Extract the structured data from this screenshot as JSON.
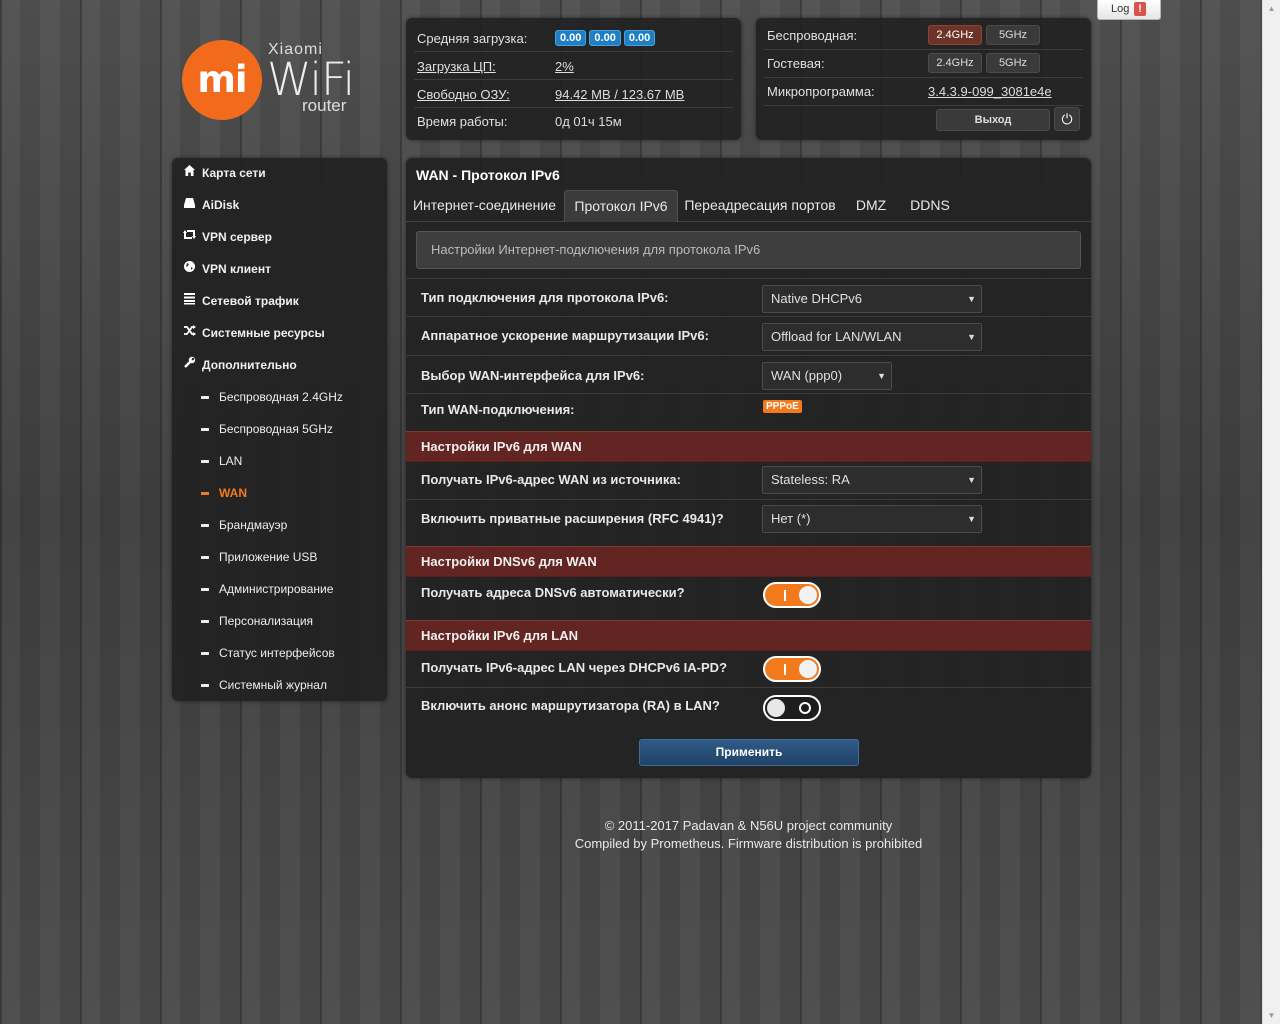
{
  "log_button": {
    "label": "Log",
    "alert": "!"
  },
  "logo": {
    "mark": "mi",
    "brand": "Xiaomi",
    "wifi": "WiFi",
    "router": "router"
  },
  "status": {
    "load_label": "Средняя загрузка:",
    "load_values": [
      "0.00",
      "0.00",
      "0.00"
    ],
    "cpu_label": "Загрузка ЦП:",
    "cpu_value": "2%",
    "ram_label": "Свободно ОЗУ:",
    "ram_value": "94.42 MB / 123.67 MB",
    "uptime_label": "Время работы:",
    "uptime_value": "0д 01ч 15м"
  },
  "wireless": {
    "wireless_label": "Беспроводная:",
    "guest_label": "Гостевая:",
    "band_24": "2.4GHz",
    "band_5": "5GHz",
    "firmware_label": "Микропрограмма:",
    "firmware_value": "3.4.3.9-099_3081e4e",
    "logout_label": "Выход"
  },
  "sidebar": {
    "items": [
      {
        "label": "Карта сети",
        "icon": "home-icon"
      },
      {
        "label": "AiDisk",
        "icon": "disk-icon"
      },
      {
        "label": "VPN сервер",
        "icon": "retweet-icon"
      },
      {
        "label": "VPN клиент",
        "icon": "globe-icon"
      },
      {
        "label": "Сетевой трафик",
        "icon": "list-icon"
      },
      {
        "label": "Системные ресурсы",
        "icon": "random-icon"
      },
      {
        "label": "Дополнительно",
        "icon": "wrench-icon"
      }
    ],
    "subitems": [
      "Беспроводная 2.4GHz",
      "Беспроводная 5GHz",
      "LAN",
      "WAN",
      "Брандмауэр",
      "Приложение USB",
      "Администрирование",
      "Персонализация",
      "Статус интерфейсов",
      "Системный журнал"
    ],
    "active": "WAN"
  },
  "main": {
    "title": "WAN - Протокол IPv6",
    "tabs": [
      "Интернет-соединение",
      "Протокол IPv6",
      "Переадресация портов",
      "DMZ",
      "DDNS"
    ],
    "active_tab": "Протокол IPv6",
    "info": "Настройки Интернет-подключения для протокола IPv6",
    "fields": {
      "conn_type_label": "Тип подключения для протокола IPv6:",
      "conn_type_value": "Native DHCPv6",
      "hw_accel_label": "Аппаратное ускорение маршрутизации IPv6:",
      "hw_accel_value": "Offload for LAN/WLAN",
      "wan_iface_label": "Выбор WAN-интерфейса для IPv6:",
      "wan_iface_value": "WAN (ppp0)",
      "wan_conn_label": "Тип WAN-подключения:",
      "wan_conn_value": "PPPoE",
      "section_wan": "Настройки IPv6 для WAN",
      "addr_source_label": "Получать IPv6-адрес WAN из источника:",
      "addr_source_value": "Stateless: RA",
      "privacy_label": "Включить приватные расширения (RFC 4941)?",
      "privacy_value": "Нет (*)",
      "section_dns": "Настройки DNSv6 для WAN",
      "dns_auto_label": "Получать адреса DNSv6 автоматически?",
      "dns_auto_on": true,
      "section_lan": "Настройки IPv6 для LAN",
      "lan_pd_label": "Получать IPv6-адрес LAN через DHCPv6 IA-PD?",
      "lan_pd_on": true,
      "ra_label": "Включить анонс маршрутизатора (RA) в LAN?",
      "ra_on": false
    },
    "apply_label": "Применить"
  },
  "footer": {
    "line1": "© 2011-2017 Padavan & N56U project community",
    "line2": "Compiled by Prometheus. Firmware distribution is prohibited"
  },
  "colors": {
    "accent": "#f27a1d",
    "section": "#6e2622",
    "badge_blue": "#1f7fc4",
    "apply": "#2a5078"
  }
}
